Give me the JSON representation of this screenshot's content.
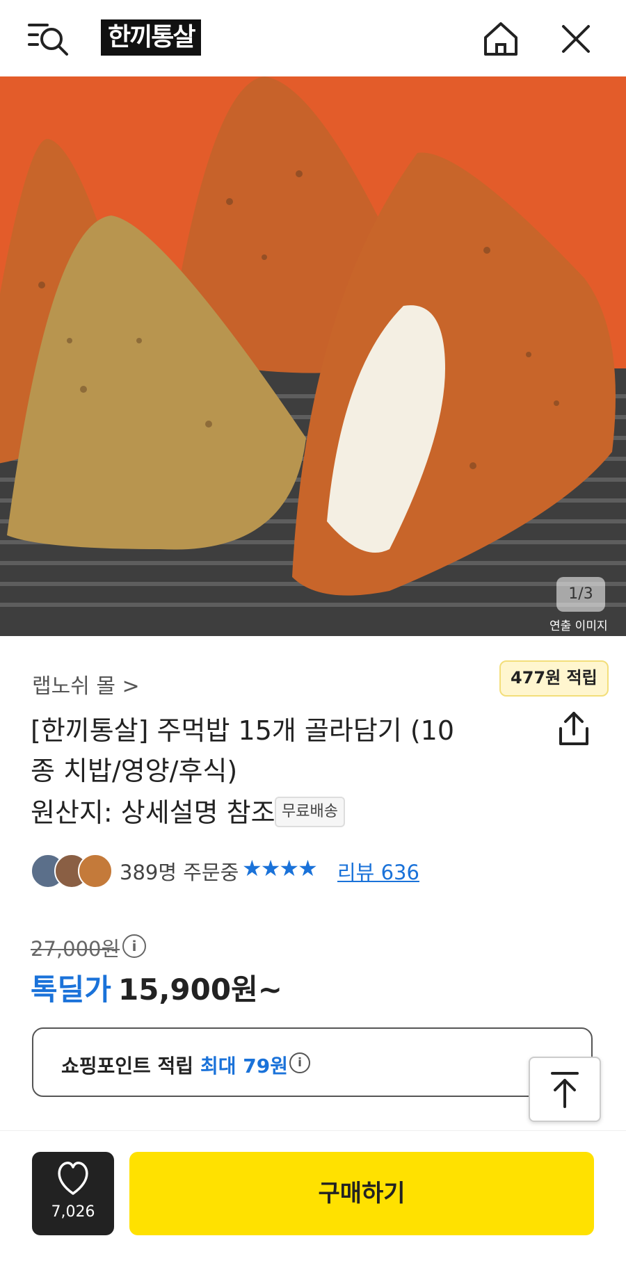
{
  "header": {
    "logo_text": "한끼통살",
    "icons": [
      "menu-search-icon",
      "home-icon",
      "close-icon"
    ]
  },
  "hero": {
    "counter": "1/3",
    "caption": "연출 이미지",
    "colors": {
      "background": "#e35c2a",
      "grill": "#4a4a4a"
    }
  },
  "product": {
    "seller": "랩노쉬 몰 >",
    "points_badge": "477원 적립",
    "title": "[한끼통살] 주먹밥 15개 골라담기 (10종 치밥/영양/후식)",
    "origin": "원산지: 상세설명 참조",
    "shipping_badge": "무료배송",
    "order_count": "389명 주문중",
    "rating_stars": "★★★★",
    "review_label": "리뷰 636"
  },
  "price": {
    "original": "27,000원",
    "deal_label": "톡딜가",
    "deal_price": "15,900원~"
  },
  "shopping_point": {
    "label": "쇼핑포인트 적립",
    "max": "최대 79원"
  },
  "bottom_bar": {
    "like_count": "7,026",
    "buy_label": "구매하기"
  },
  "colors": {
    "accent_blue": "#1a72d9",
    "buy_yellow": "#ffe100",
    "like_dark": "#222222"
  }
}
